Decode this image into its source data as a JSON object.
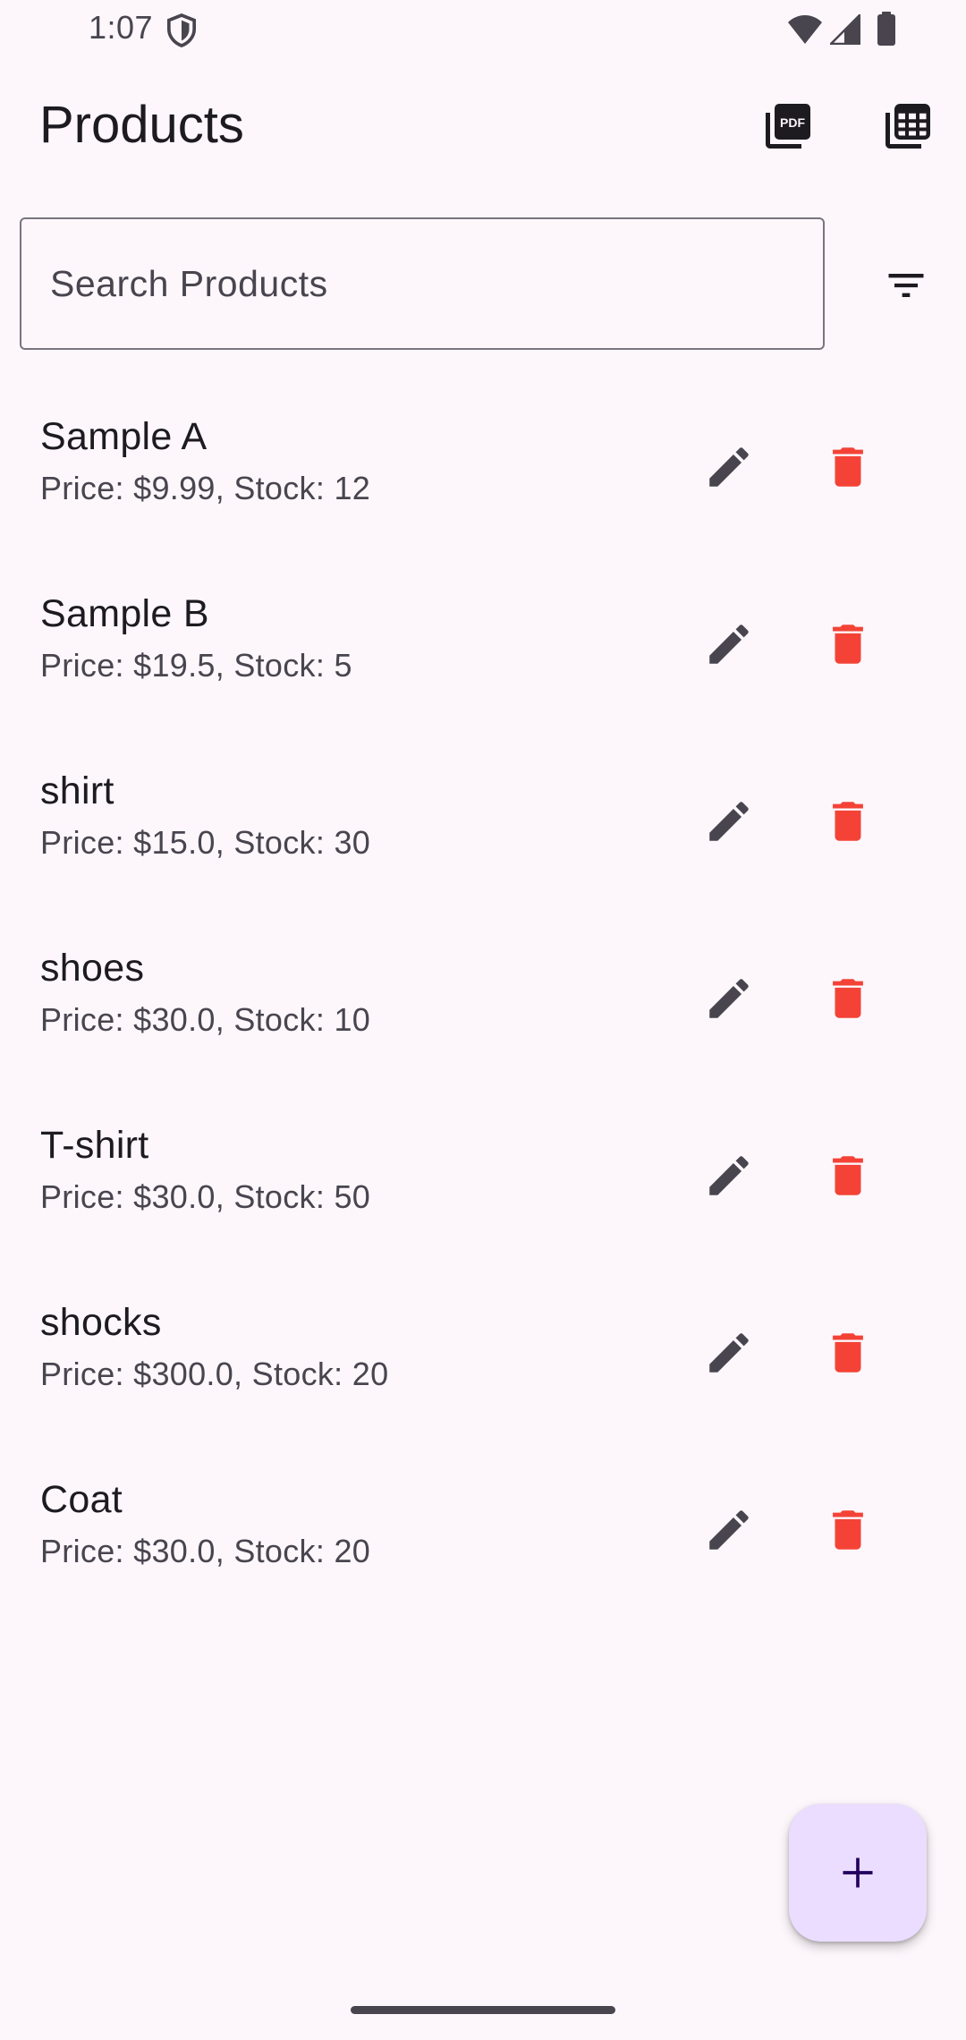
{
  "status_bar": {
    "time": "1:07",
    "icons": [
      "shield-icon",
      "wifi-icon",
      "signal-icon",
      "battery-icon"
    ]
  },
  "app_bar": {
    "title": "Products",
    "actions": [
      {
        "name": "pdf-export",
        "icon": "picture-as-pdf-icon"
      },
      {
        "name": "spreadsheet-export",
        "icon": "table-view-icon"
      }
    ]
  },
  "search": {
    "placeholder": "Search Products",
    "value": "",
    "filter_icon": "filter-list-icon"
  },
  "products": [
    {
      "name": "Sample A",
      "details": "Price: $9.99, Stock: 12"
    },
    {
      "name": "Sample B",
      "details": "Price: $19.5, Stock: 5"
    },
    {
      "name": "shirt",
      "details": "Price: $15.0, Stock: 30"
    },
    {
      "name": "shoes",
      "details": "Price: $30.0, Stock: 10"
    },
    {
      "name": "T-shirt",
      "details": "Price: $30.0, Stock: 50"
    },
    {
      "name": "shocks",
      "details": "Price: $300.0, Stock: 20"
    },
    {
      "name": "Coat",
      "details": "Price: $30.0, Stock: 20"
    }
  ],
  "row_actions": {
    "edit_icon": "edit-icon",
    "delete_icon": "delete-icon"
  },
  "fab": {
    "icon": "add-icon"
  },
  "colors": {
    "background": "#FDF7FC",
    "text_primary": "#1D1B20",
    "text_secondary": "#49454F",
    "delete": "#F44336",
    "fab_bg": "#EADDFF",
    "fab_icon": "#21005D"
  }
}
